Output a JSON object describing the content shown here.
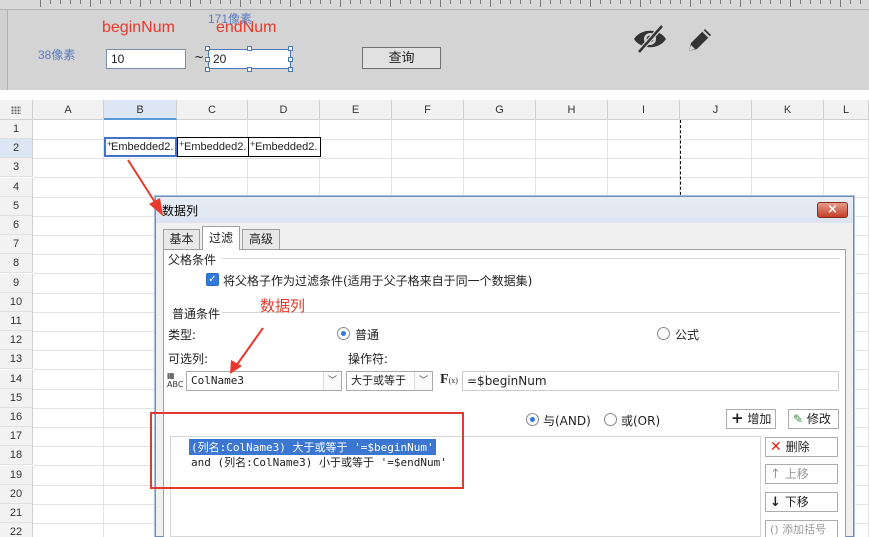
{
  "parameters": {
    "begin_label": "beginNum",
    "end_label": "endNum",
    "width_hint": "171像素",
    "height_hint": "38像素",
    "begin_value": "10",
    "tilde": "~",
    "end_value": "20",
    "query_label": "查询",
    "hide_icon": "eye-off-icon",
    "edit_icon": "pencil-icon"
  },
  "sheet": {
    "columns": [
      "A",
      "B",
      "C",
      "D",
      "E",
      "F",
      "G",
      "H",
      "I",
      "J",
      "K",
      "L"
    ],
    "rows": [
      "1",
      "2",
      "3",
      "4",
      "5",
      "6",
      "7",
      "8",
      "9",
      "10",
      "11",
      "12",
      "13",
      "14",
      "15",
      "16",
      "17",
      "18",
      "19",
      "20",
      "21",
      "22"
    ],
    "cells": [
      "Embedded2.",
      "Embedded2.",
      "Embedded2."
    ]
  },
  "dialog": {
    "title": "数据列",
    "close": "×",
    "tabs": [
      "基本",
      "过滤",
      "高级"
    ],
    "parent_section": "父格条件",
    "parent_checkbox": "将父格子作为过滤条件(适用于父子格来自于同一个数据集)",
    "normal_section": "普通条件",
    "type_label": "类型:",
    "type_normal": "普通",
    "type_formula": "公式",
    "column_label": "可选列:",
    "operator_label": "操作符:",
    "column_value": "ColName3",
    "operator_value": "大于或等于",
    "fx_label": "F",
    "expression_value": "=$beginNum",
    "and_label": "与(AND)",
    "or_label": "或(OR)",
    "add_label": "增加",
    "modify_label": "修改",
    "delete_label": "删除",
    "up_label": "上移",
    "down_label": "下移",
    "bracket_label": "添加括号",
    "conditions": [
      "(列名:ColName3) 大于或等于 '=$beginNum'",
      "and (列名:ColName3) 小于或等于 '=$endNum'"
    ]
  },
  "annotations": {
    "column_note": "数据列"
  },
  "colors": {
    "annotation_red": "#e8392c",
    "selection_blue": "#3b77d1"
  }
}
